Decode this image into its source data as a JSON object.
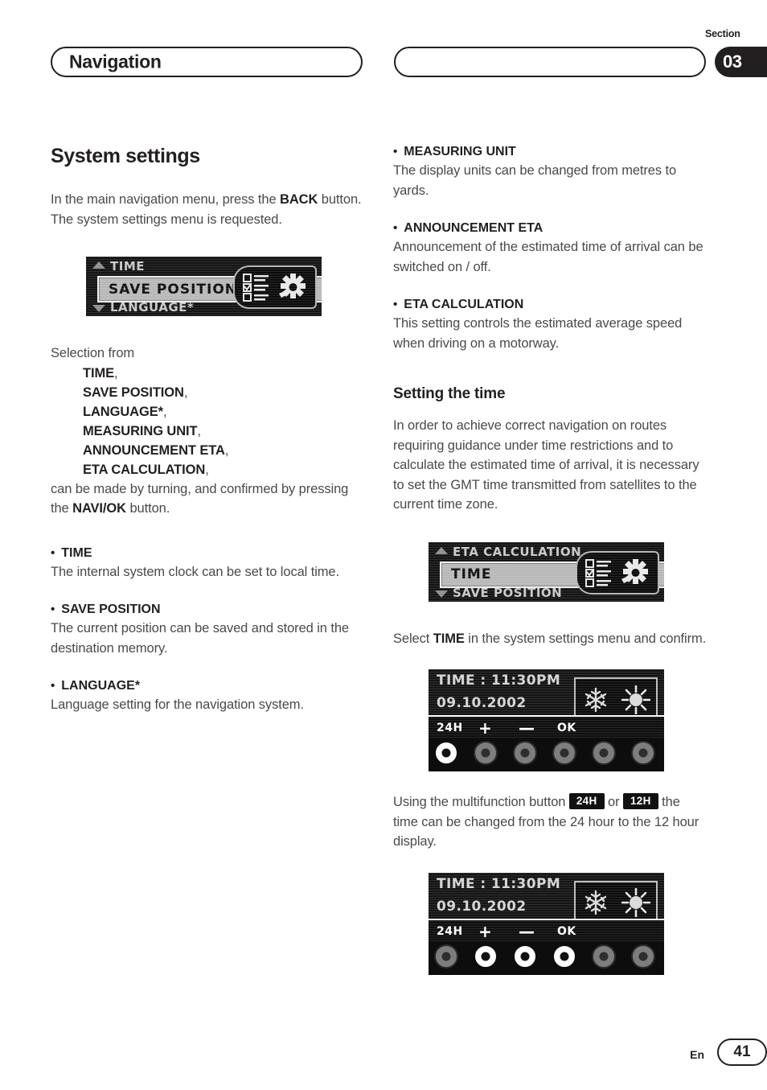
{
  "header": {
    "chapter_title": "Navigation",
    "section_label": "Section",
    "section_number": "03"
  },
  "left_column": {
    "heading": "System settings",
    "intro_line1_a": "In the main navigation menu, press the ",
    "intro_line1_b": "BACK",
    "intro_line1_c": " button.",
    "intro_line2": "The system settings menu is requested.",
    "lcd_menu": {
      "top_item": "TIME",
      "selected_item": "SAVE POSITION",
      "bottom_item": "LANGUAGE*",
      "icon": "settings-checklist-gear-icon"
    },
    "selection_intro": "Selection from",
    "menu_items": [
      "TIME",
      "SAVE POSITION",
      "LANGUAGE*",
      "MEASURING UNIT",
      "ANNOUNCEMENT ETA",
      "ETA CALCULATION"
    ],
    "selection_outro_a": "can be made by turning, and confirmed by pressing the ",
    "selection_outro_b": "NAVI/OK",
    "selection_outro_c": " button.",
    "bullets": [
      {
        "title": "TIME",
        "body": "The internal system clock can be set to local time."
      },
      {
        "title": "SAVE POSITION",
        "body": "The current position can be saved and stored in the destination memory."
      },
      {
        "title": "LANGUAGE*",
        "body": "Language setting for the navigation system."
      }
    ]
  },
  "right_column": {
    "bullets": [
      {
        "title": "MEASURING UNIT",
        "body": "The display units can be changed from metres to yards."
      },
      {
        "title": "ANNOUNCEMENT ETA",
        "body": "Announcement of the estimated time of arrival can be switched on / off."
      },
      {
        "title": "ETA CALCULATION",
        "body": "This setting controls the estimated average speed when driving on a motorway."
      }
    ],
    "heading": "Setting the time",
    "intro": "In order to achieve correct navigation on routes requiring guidance under time restrictions and to calculate the estimated time of arrival, it is necessary to set the GMT time transmitted from satellites to the current time zone.",
    "lcd_menu": {
      "top_item": "ETA CALCULATION",
      "selected_item": "TIME",
      "bottom_item": "SAVE POSITION",
      "icon": "settings-checklist-gear-icon"
    },
    "select_line_a": "Select ",
    "select_line_b": "TIME",
    "select_line_c": " in the system settings menu and confirm.",
    "lcd_time_1": {
      "time_line": "TIME : 11:30PM",
      "date_line": "09.10.2002",
      "icons": [
        "snowflake-icon",
        "sun-icon"
      ],
      "button_labels": [
        "24H",
        "+",
        "—",
        "OK"
      ],
      "button_states": [
        "on",
        "off",
        "off",
        "off",
        "off",
        "off"
      ]
    },
    "multifunction_text_a": "Using the multifunction button ",
    "multifunction_badge_1": "24H",
    "multifunction_text_b": " or ",
    "multifunction_badge_2": "12H",
    "multifunction_text_c": " the time can be changed from the 24 hour to the 12 hour display.",
    "lcd_time_2": {
      "time_line": "TIME : 11:30PM",
      "date_line": "09.10.2002",
      "icons": [
        "snowflake-icon",
        "sun-icon"
      ],
      "button_labels": [
        "24H",
        "+",
        "—",
        "OK"
      ],
      "button_states": [
        "off",
        "on",
        "on",
        "on",
        "off",
        "off"
      ]
    }
  },
  "footer": {
    "language": "En",
    "page_number": "41"
  }
}
